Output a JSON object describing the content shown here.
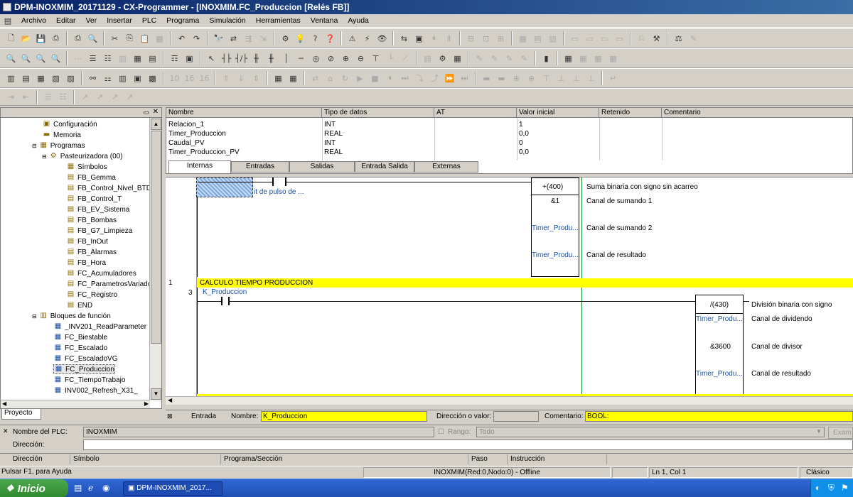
{
  "window": {
    "title": "DPM-INOXMIM_20171129 - CX-Programmer - [INOXMIM.FC_Produccion [Relés FB]]"
  },
  "menu": [
    "Archivo",
    "Editar",
    "Ver",
    "Insertar",
    "PLC",
    "Programa",
    "Simulación",
    "Herramientas",
    "Ventana",
    "Ayuda"
  ],
  "tree": {
    "items": [
      {
        "label": "Configuración",
        "icon": "config-icon"
      },
      {
        "label": "Memoria",
        "icon": "memory-icon"
      },
      {
        "label": "Programas",
        "icon": "programs-icon"
      },
      {
        "label": "Pasteurizadora (00)",
        "icon": "task-icon"
      },
      {
        "label": "Símbolos",
        "icon": "symbols-icon"
      },
      {
        "label": "FB_Gemma",
        "icon": "section-icon"
      },
      {
        "label": "FB_Control_Nivel_BTD",
        "icon": "section-icon"
      },
      {
        "label": "FB_Control_T",
        "icon": "section-icon"
      },
      {
        "label": "FB_EV_Sistema",
        "icon": "section-icon"
      },
      {
        "label": "FB_Bombas",
        "icon": "section-icon"
      },
      {
        "label": "FB_G7_Limpieza",
        "icon": "section-icon"
      },
      {
        "label": "FB_InOut",
        "icon": "section-icon"
      },
      {
        "label": "FB_Alarmas",
        "icon": "section-icon"
      },
      {
        "label": "FB_Hora",
        "icon": "section-icon"
      },
      {
        "label": "FC_Acumuladores",
        "icon": "section-icon"
      },
      {
        "label": "FC_ParametrosVariado",
        "icon": "section-icon"
      },
      {
        "label": "FC_Registro",
        "icon": "section-icon"
      },
      {
        "label": "END",
        "icon": "section-icon"
      },
      {
        "label": "Bloques de función",
        "icon": "function-blocks-icon"
      },
      {
        "label": "_INV201_ReadParameter",
        "icon": "fb-icon"
      },
      {
        "label": "FC_Biestable",
        "icon": "fb-icon"
      },
      {
        "label": "FC_Escalado",
        "icon": "fb-icon"
      },
      {
        "label": "FC_EscaladoVG",
        "icon": "fb-icon"
      },
      {
        "label": "FC_Produccion",
        "icon": "fb-icon"
      },
      {
        "label": "FC_TiempoTrabajo",
        "icon": "fb-icon"
      },
      {
        "label": "INV002_Refresh_X31_",
        "icon": "fb-icon"
      }
    ]
  },
  "project_tab": "Proyecto",
  "vars": {
    "headers": [
      "Nombre",
      "Tipo de datos",
      "AT",
      "Valor inicial",
      "Retenido",
      "Comentario"
    ],
    "rows": [
      {
        "name": "Relacion_1",
        "type": "INT",
        "init": "1"
      },
      {
        "name": "Timer_Produccion",
        "type": "REAL",
        "init": "0,0"
      },
      {
        "name": "Caudal_PV",
        "type": "INT",
        "init": "0"
      },
      {
        "name": "Timer_Produccion_PV",
        "type": "REAL",
        "init": "0,0"
      }
    ],
    "tabs": [
      "Internas",
      "Entradas",
      "Salidas",
      "Entrada Salida",
      "Externas"
    ]
  },
  "ladder": {
    "top_contact_comment": "it de pulso de ...",
    "add_instr": "+(400)",
    "add_desc": "Suma binaria con signo sin acarreo",
    "add_op1": "&1",
    "add_op1_desc": "Canal de sumando 1",
    "add_op2": "Timer_Produ...",
    "add_op2_desc": "Canal de sumando 2",
    "add_op3": "Timer_Produ...",
    "add_op3_desc": "Canal de resultado",
    "rung_num": "1",
    "rung_step": "3",
    "rung_comment": "CALCULO TIEMPO PRODUCCION",
    "contact_label": "K_Produccion",
    "div_instr": "/(430)",
    "div_desc": "División binaria con signo",
    "div_op1": "Timer_Produ...",
    "div_op1_desc": "Canal de dividendo",
    "div_op2": "&3600",
    "div_op2_desc": "Canal de divisor",
    "div_op3": "Timer_Produ...",
    "div_op3_desc": "Canal de resultado"
  },
  "entry": {
    "type": "Entrada",
    "name_label": "Nombre:",
    "name_value": "K_Produccion",
    "addr_label": "Dirección o valor:",
    "comment_label": "Comentario:",
    "comment_value": "BOOL:"
  },
  "plc_panel": {
    "plc_name_label": "Nombre del PLC:",
    "plc_name": "INOXMIM",
    "dir_label": "Dirección:",
    "range_label": "Rango:",
    "range_value": "Todo",
    "exam_label": "Exam"
  },
  "output_headers": [
    "Dirección",
    "Símbolo",
    "Programa/Sección",
    "Paso",
    "Instrucción"
  ],
  "status": {
    "help": "Pulsar F1, para Ayuda",
    "plc": "INOXMIM(Red:0,Nodo:0) - Offline",
    "pos": "Ln 1, Col 1",
    "mode": "Clásico"
  },
  "taskbar": {
    "start": "Inicio",
    "task": "DPM-INOXMIM_2017..."
  }
}
